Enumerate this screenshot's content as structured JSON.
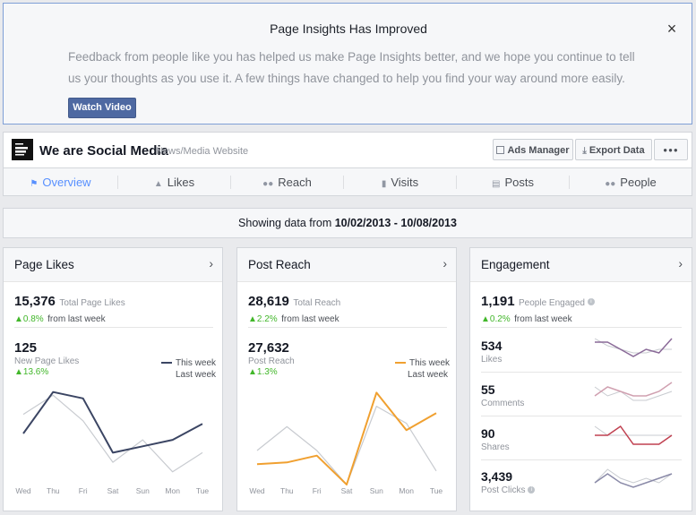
{
  "notice": {
    "title": "Page Insights Has Improved",
    "close": "×",
    "body": "Feedback from people like you has helped us make Page Insights better, and we hope you continue to tell us your thoughts as you use it. A few things have changed to help you find your way around more easily.",
    "button": "Watch Video"
  },
  "header": {
    "logo_text": "We are Social Media",
    "page_name": "We are Social Media",
    "category": "News/Media Website",
    "ads_manager": "Ads Manager",
    "export_data": "Export Data",
    "more": "●●●"
  },
  "tabs": [
    {
      "label": "Overview",
      "icon": "flag-icon"
    },
    {
      "label": "Likes",
      "icon": "thumb-icon"
    },
    {
      "label": "Reach",
      "icon": "people-icon"
    },
    {
      "label": "Visits",
      "icon": "bars-icon"
    },
    {
      "label": "Posts",
      "icon": "posts-icon"
    },
    {
      "label": "People",
      "icon": "people-icon"
    }
  ],
  "date_range": {
    "prefix": "Showing data from ",
    "range": "10/02/2013 - 10/08/2013"
  },
  "cards": {
    "page_likes": {
      "title": "Page Likes",
      "total_value": "15,376",
      "total_label": "Total Page Likes",
      "total_change": "▲0.8%",
      "total_change_suffix": "from last week",
      "new_value": "125",
      "new_label": "New Page Likes",
      "new_change": "▲13.6%",
      "legend_this": "This week",
      "legend_last": "Last week"
    },
    "post_reach": {
      "title": "Post Reach",
      "total_value": "28,619",
      "total_label": "Total Reach",
      "total_change": "▲2.2%",
      "total_change_suffix": "from last week",
      "new_value": "27,632",
      "new_label": "Post Reach",
      "new_change": "▲1.3%",
      "legend_this": "This week",
      "legend_last": "Last week"
    },
    "engagement": {
      "title": "Engagement",
      "total_value": "1,191",
      "total_label": "People Engaged",
      "total_change": "▲0.2%",
      "total_change_suffix": "from last week",
      "rows": [
        {
          "value": "534",
          "label": "Likes"
        },
        {
          "value": "55",
          "label": "Comments"
        },
        {
          "value": "90",
          "label": "Shares"
        },
        {
          "value": "3,439",
          "label": "Post Clicks"
        }
      ]
    }
  },
  "colors": {
    "likes_this_week": "#3b4563",
    "reach_this_week": "#f0a030",
    "last_week": "#c8cbd0",
    "accent": "#5890ff",
    "positive": "#42b72a",
    "spark_likes": "#8a6a98",
    "spark_comments": "#d0a0b0",
    "spark_shares": "#c04050",
    "spark_clicks": "#8a8aa8"
  },
  "chart_data": [
    {
      "type": "line",
      "categories": [
        "Wed",
        "Thu",
        "Fri",
        "Sat",
        "Sun",
        "Mon",
        "Tue"
      ],
      "series": [
        {
          "name": "This week",
          "values": [
            16,
            29,
            27,
            10,
            12,
            14,
            19
          ]
        },
        {
          "name": "Last week",
          "values": [
            22,
            28,
            20,
            7,
            14,
            4,
            10
          ]
        }
      ],
      "ylim": [
        0,
        32
      ]
    },
    {
      "type": "line",
      "categories": [
        "Wed",
        "Thu",
        "Fri",
        "Sat",
        "Sun",
        "Mon",
        "Tue"
      ],
      "series": [
        {
          "name": "This week",
          "values": [
            6,
            6.5,
            8.5,
            0,
            27,
            16,
            21
          ]
        },
        {
          "name": "Last week",
          "values": [
            10,
            17,
            10,
            0,
            23,
            18,
            4
          ]
        }
      ],
      "ylim": [
        0,
        30
      ]
    }
  ],
  "sparklines": {
    "likes": {
      "this_week": [
        5,
        5,
        3,
        1,
        3,
        2,
        6
      ],
      "last_week": [
        6,
        4,
        3,
        2,
        2,
        3,
        3
      ]
    },
    "comments": {
      "this_week": [
        3,
        5,
        4,
        3,
        3,
        4,
        6
      ],
      "last_week": [
        5,
        3,
        4,
        2,
        2,
        3,
        4
      ]
    },
    "shares": {
      "this_week": [
        3,
        3,
        4,
        2,
        2,
        2,
        3
      ],
      "last_week": [
        4,
        3,
        3,
        3,
        3,
        3,
        3
      ]
    },
    "clicks": {
      "this_week": [
        2,
        4,
        2,
        1,
        2,
        3,
        4
      ],
      "last_week": [
        2,
        5,
        3,
        2,
        3,
        2,
        4
      ]
    }
  }
}
